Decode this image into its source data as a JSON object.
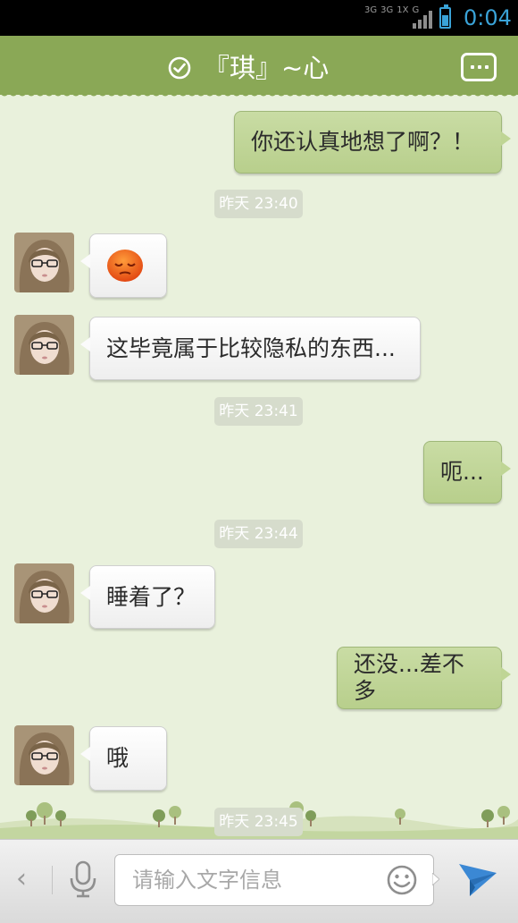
{
  "status_bar": {
    "network_labels": [
      "3G",
      "3G",
      "1X",
      "G"
    ],
    "time": "0:04",
    "accent_color": "#3aa3d8"
  },
  "header": {
    "status_icon": "check-circle-icon",
    "title": "『琪』~心",
    "menu_icon": "more-dots-icon",
    "background_color": "#8aa856"
  },
  "messages": [
    {
      "side": "out",
      "text": "你还认真地想了啊？！"
    },
    {
      "timestamp": "昨天 23:40"
    },
    {
      "side": "in",
      "emoji": "sad-face-emoji"
    },
    {
      "side": "in",
      "text": "这毕竟属于比较隐私的东西..."
    },
    {
      "timestamp": "昨天 23:41"
    },
    {
      "side": "out",
      "text": "呃..."
    },
    {
      "timestamp": "昨天 23:44"
    },
    {
      "side": "in",
      "text": "睡着了？"
    },
    {
      "side": "out",
      "text": "还没...差不多"
    },
    {
      "side": "in",
      "text": "哦"
    },
    {
      "timestamp": "昨天 23:45"
    }
  ],
  "input_bar": {
    "back_icon": "chevron-left-icon",
    "mic_icon": "microphone-icon",
    "placeholder": "请输入文字信息",
    "emoji_icon": "smiley-icon",
    "send_icon": "paper-plane-icon"
  }
}
